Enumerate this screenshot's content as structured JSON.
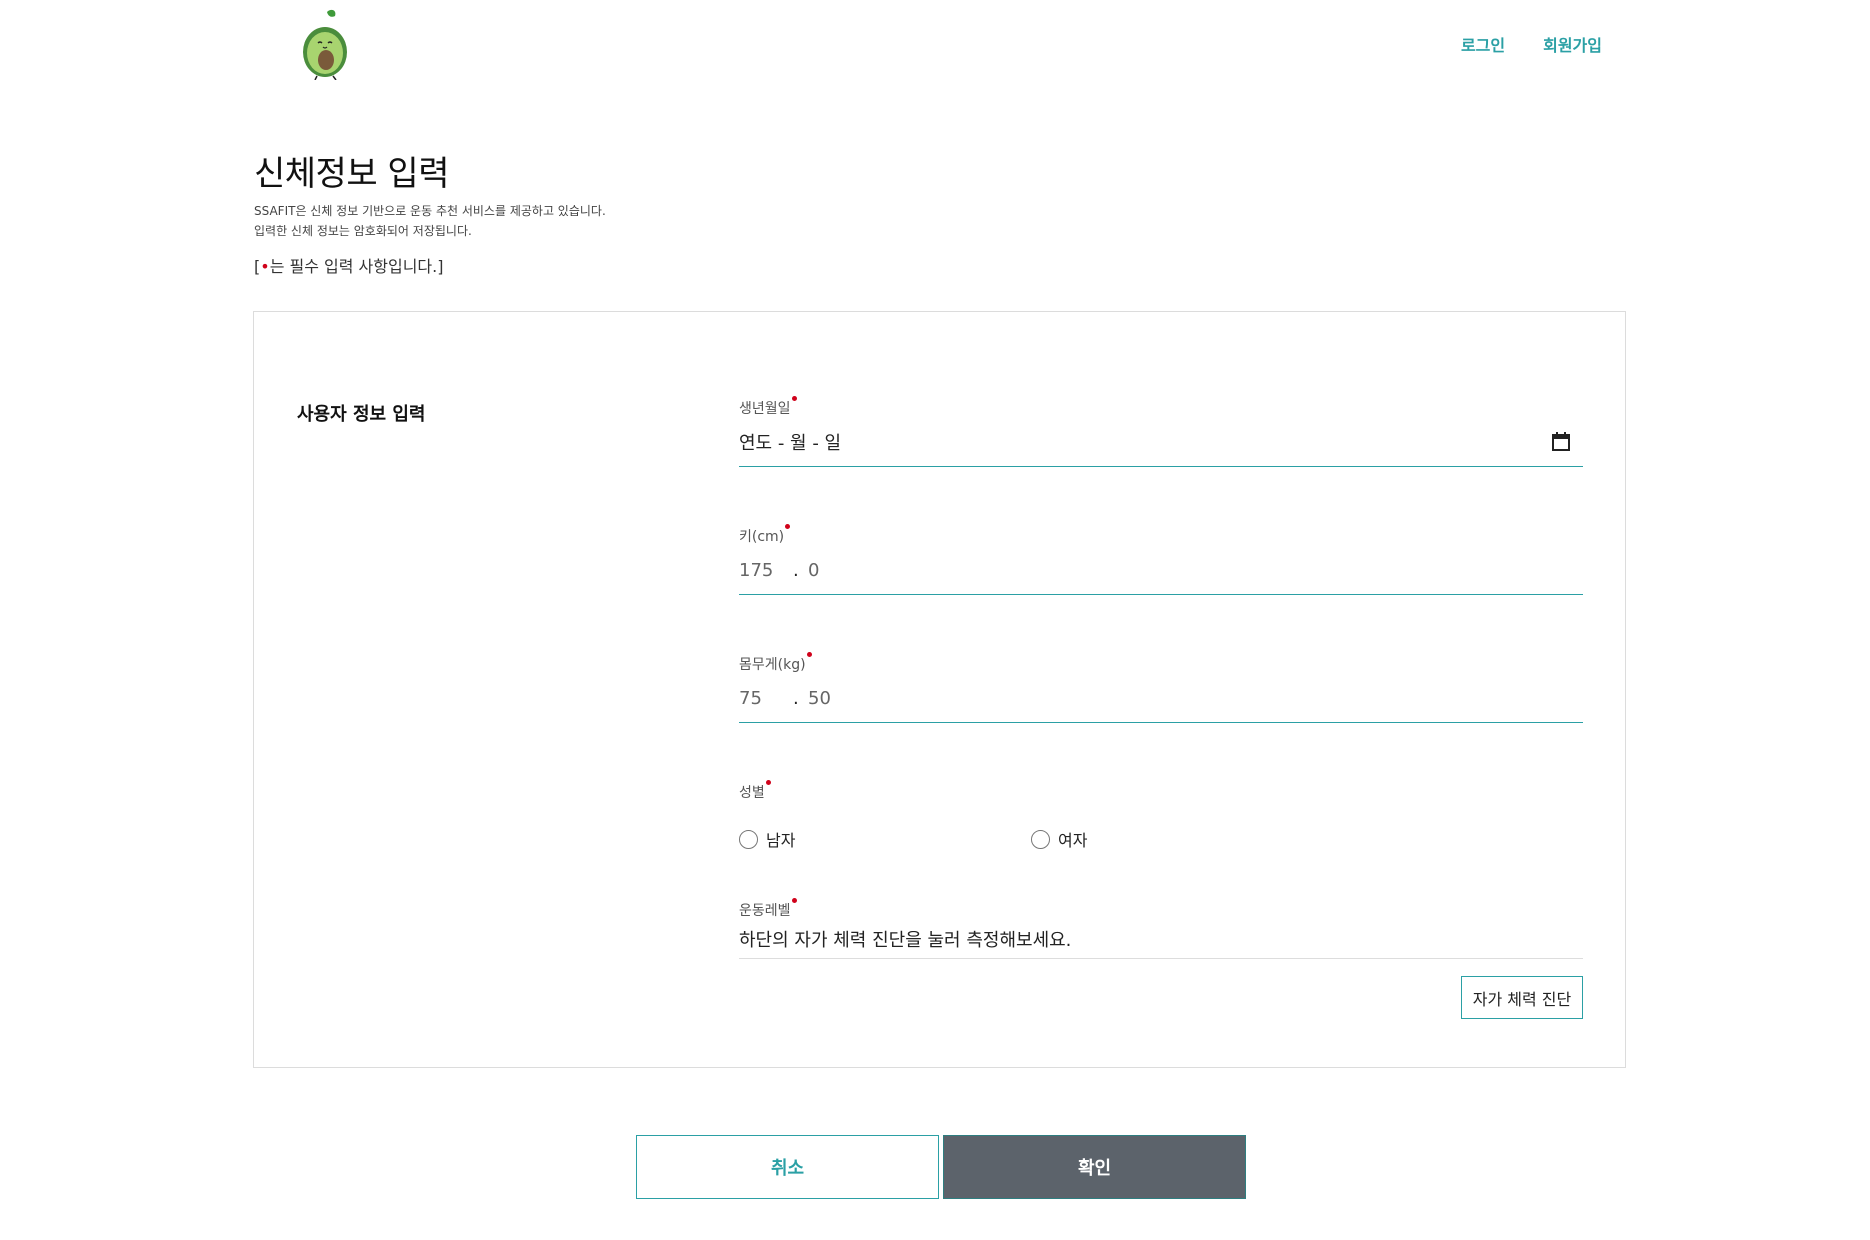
{
  "header": {
    "logo_icon": "avocado-mascot-icon",
    "login_label": "로그인",
    "signup_label": "회원가입",
    "accent_color": "#2ba0a5"
  },
  "intro": {
    "title": "신체정보 입력",
    "desc_line1": "SSAFIT은 신체 정보 기반으로 운동 추천 서비스를 제공하고 있습니다.",
    "desc_line2": "입력한 신체 정보는 암호화되어 저장됩니다.",
    "required_prefix": "[",
    "required_mark": "•",
    "required_suffix": "는 필수 입력 사항입니다.]",
    "required_color": "#d0021b"
  },
  "card": {
    "section_title": "사용자 정보 입력",
    "birth": {
      "label": "생년월일",
      "placeholder": "연도 - 월 - 일",
      "icon": "calendar-icon"
    },
    "height": {
      "label": "키(cm)",
      "int": "175",
      "sep": ".",
      "dec": "0"
    },
    "weight": {
      "label": "몸무게(kg)",
      "int": "75",
      "sep": ".",
      "dec": "50"
    },
    "gender": {
      "label": "성별",
      "options": [
        "남자",
        "여자"
      ]
    },
    "level": {
      "label": "운동레벨",
      "text": "하단의 자가 체력 진단을 눌러 측정해보세요.",
      "button": "자가 체력 진단"
    }
  },
  "actions": {
    "cancel": "취소",
    "confirm": "확인"
  }
}
